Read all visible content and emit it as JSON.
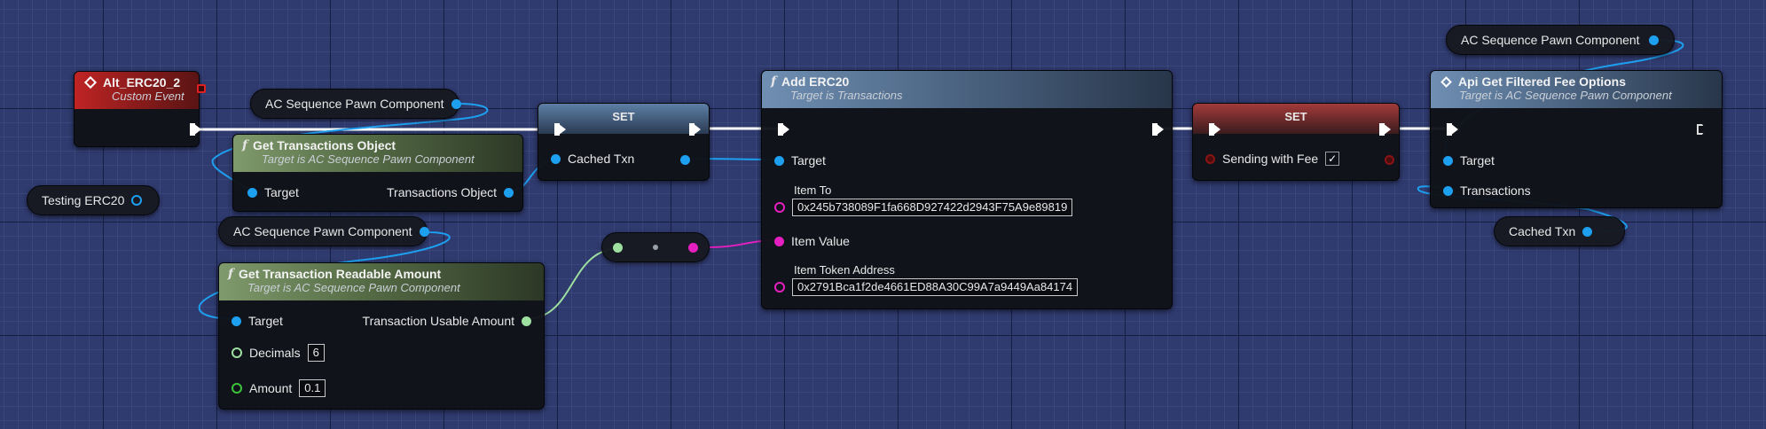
{
  "colors": {
    "graph_bg": "#2f3a6e",
    "exec_wire": "#ffffff",
    "object_pin": "#1ea0f0",
    "float_pin": "#9ee0a0",
    "string_pin": "#e61fc0",
    "bool_pin": "#8a1414"
  },
  "event_node": {
    "title": "Alt_ERC20_2",
    "subtitle": "Custom Event",
    "icon": "event-diamond-icon"
  },
  "var_nodes": {
    "pawn_component_1": "AC Sequence Pawn Component",
    "pawn_component_2": "AC Sequence Pawn Component",
    "pawn_component_3": "AC Sequence Pawn Component",
    "testing_erc20": "Testing ERC20",
    "cached_txn": "Cached Txn"
  },
  "get_transactions_object": {
    "title": "Get Transactions Object",
    "subtitle": "Target is AC Sequence Pawn Component",
    "target_label": "Target",
    "output_label": "Transactions Object",
    "icon": "function-icon"
  },
  "set_cached_txn": {
    "title": "SET",
    "pin_label": "Cached Txn"
  },
  "get_transaction_readable_amount": {
    "title": "Get Transaction Readable Amount",
    "subtitle": "Target is AC Sequence Pawn Component",
    "target_label": "Target",
    "output_label": "Transaction Usable Amount",
    "decimals_label": "Decimals",
    "decimals_value": "6",
    "amount_label": "Amount",
    "amount_value": "0.1",
    "icon": "function-icon"
  },
  "conversion_node": {
    "icon": "conversion-dot-icon"
  },
  "add_erc20": {
    "title": "Add ERC20",
    "subtitle": "Target is Transactions",
    "target_label": "Target",
    "item_to_label": "Item To",
    "item_to_value": "0x245b738089F1fa668D927422d2943F75A9e89819",
    "item_value_label": "Item Value",
    "item_token_address_label": "Item Token Address",
    "item_token_address_value": "0x2791Bca1f2de4661ED88A30C99A7a9449Aa84174",
    "icon": "function-icon"
  },
  "set_sending_fee": {
    "title": "SET",
    "pin_label": "Sending with Fee",
    "checked": true
  },
  "api_get_filtered_fee_options": {
    "title": "Api Get Filtered Fee Options",
    "subtitle": "Target is AC Sequence Pawn Component",
    "target_label": "Target",
    "transactions_label": "Transactions",
    "icon": "latent-function-icon"
  }
}
